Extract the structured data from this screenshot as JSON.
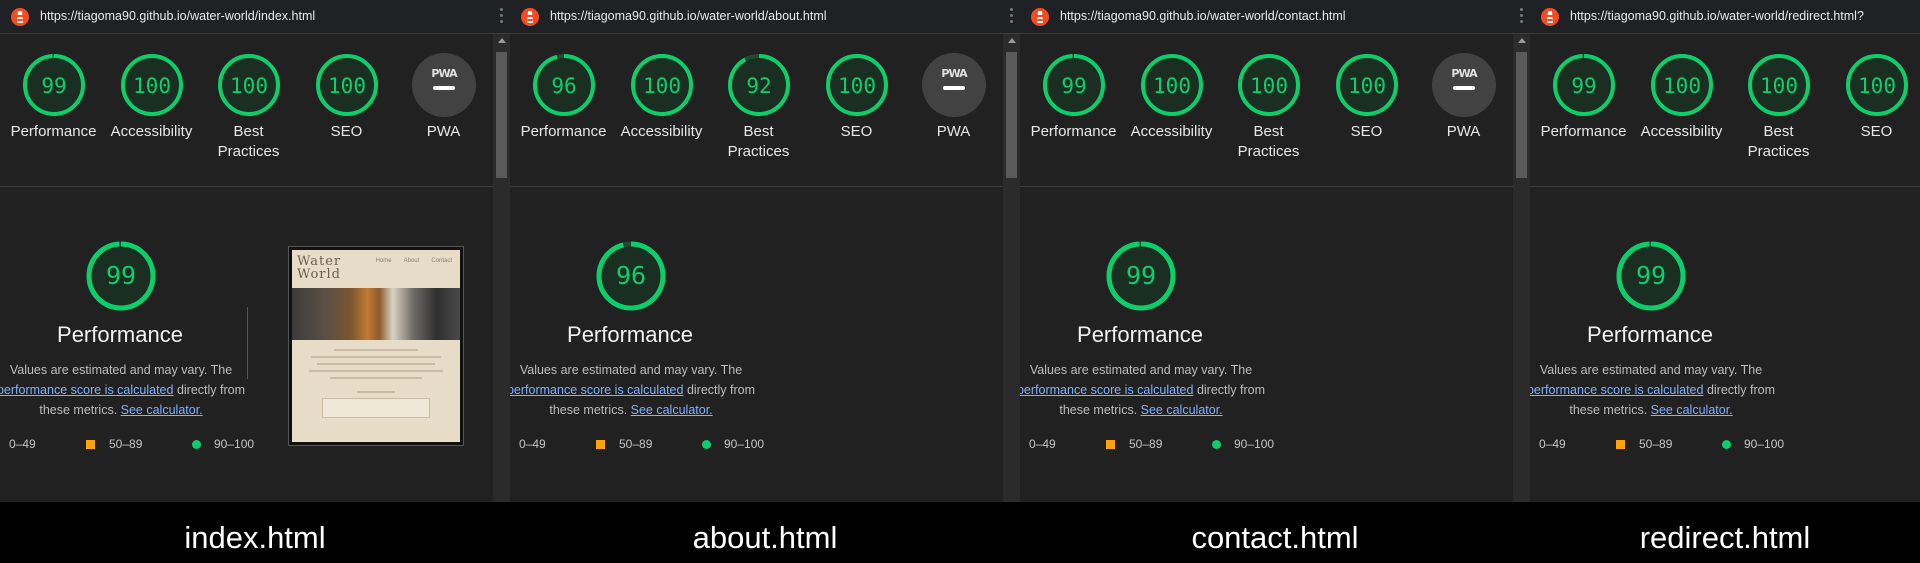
{
  "colors": {
    "pass": "#0cce6b",
    "average": "#ffa400",
    "panel_bg": "#212121"
  },
  "panels": [
    {
      "url": "https://tiagoma90.github.io/water-world/index.html",
      "caption": "index.html",
      "scores": {
        "performance": "99",
        "accessibility": "100",
        "best_practices": "100",
        "seo": "100"
      },
      "main_score": "99",
      "show_pwa": true
    },
    {
      "url": "https://tiagoma90.github.io/water-world/about.html",
      "caption": "about.html",
      "scores": {
        "performance": "96",
        "accessibility": "100",
        "best_practices": "92",
        "seo": "100"
      },
      "main_score": "96",
      "show_pwa": true
    },
    {
      "url": "https://tiagoma90.github.io/water-world/contact.html",
      "caption": "contact.html",
      "scores": {
        "performance": "99",
        "accessibility": "100",
        "best_practices": "100",
        "seo": "100"
      },
      "main_score": "99",
      "show_pwa": true
    },
    {
      "url": "https://tiagoma90.github.io/water-world/redirect.html?",
      "caption": "redirect.html",
      "scores": {
        "performance": "99",
        "accessibility": "100",
        "best_practices": "100",
        "seo": "100"
      },
      "main_score": "99",
      "show_pwa": false
    }
  ],
  "labels": {
    "performance": "Performance",
    "accessibility": "Accessibility",
    "best1": "Best",
    "best2": "Practices",
    "seo": "SEO",
    "pwa": "PWA",
    "pwa_badge": "PWA",
    "desc1": "Values are estimated and may vary. The ",
    "desc_link": "performance score is calculated",
    "desc2": " directly from these metrics. ",
    "desc_link2": "See calculator.",
    "legend_fail": "0–49",
    "legend_avg": "50–89",
    "legend_pass": "90–100"
  },
  "thumb": {
    "logo1": "Water",
    "logo2": "World",
    "logo_wide": "Water World",
    "nav": [
      "Home",
      "About",
      "Contact"
    ]
  },
  "icons": {
    "lighthouse": "lighthouse-icon",
    "menu": "kebab-menu-icon"
  }
}
